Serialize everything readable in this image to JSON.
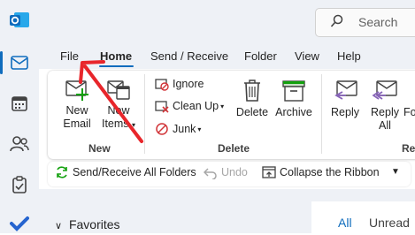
{
  "app": {
    "name": "Outlook",
    "brand_color": "#0f6cbd"
  },
  "search": {
    "placeholder": "Search"
  },
  "menu": {
    "tabs": [
      "File",
      "Home",
      "Send / Receive",
      "Folder",
      "View",
      "Help"
    ],
    "active": "Home"
  },
  "ribbon": {
    "new_group": {
      "new_email": "New\nEmail",
      "new_items": "New\nItems",
      "label": "New"
    },
    "delete_group": {
      "ignore": "Ignore",
      "clean_up": "Clean Up",
      "junk": "Junk",
      "delete": "Delete",
      "archive": "Archive",
      "label": "Delete"
    },
    "respond_group": {
      "reply": "Reply",
      "reply_all": "Reply\nAll",
      "forward_partial": "Fo",
      "label_partial": "Re"
    }
  },
  "qat": {
    "send_receive_all": "Send/Receive All Folders",
    "undo": "Undo",
    "collapse_ribbon": "Collapse the Ribbon"
  },
  "sidebar": {
    "favorites": "Favorites"
  },
  "message_list": {
    "tabs": [
      "All",
      "Unread"
    ]
  },
  "annotation": {
    "arrow_color": "#e8262b"
  }
}
